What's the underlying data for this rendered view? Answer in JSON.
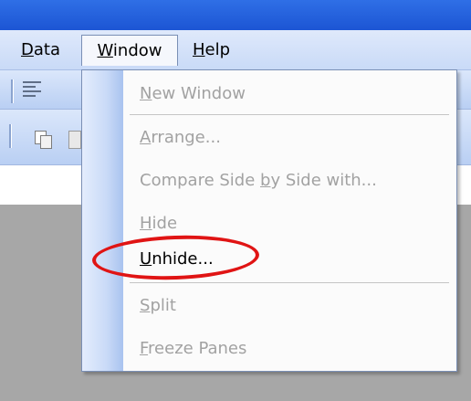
{
  "menubar": {
    "items": [
      {
        "prefix": "",
        "mnemonic": "D",
        "rest": "ata"
      },
      {
        "prefix": "",
        "mnemonic": "W",
        "rest": "indow"
      },
      {
        "prefix": "",
        "mnemonic": "H",
        "rest": "elp"
      }
    ],
    "active": "Window"
  },
  "window_menu": {
    "items": [
      {
        "prefix": "",
        "mnemonic": "N",
        "rest": "ew Window",
        "enabled": false
      },
      {
        "prefix": "",
        "mnemonic": "A",
        "rest": "rrange...",
        "enabled": false
      },
      {
        "prefix": "Compare Side ",
        "mnemonic": "b",
        "rest": "y Side with...",
        "enabled": false
      },
      {
        "prefix": "",
        "mnemonic": "H",
        "rest": "ide",
        "enabled": false
      },
      {
        "prefix": "",
        "mnemonic": "U",
        "rest": "nhide...",
        "enabled": true
      },
      {
        "prefix": "",
        "mnemonic": "S",
        "rest": "plit",
        "enabled": false
      },
      {
        "prefix": "",
        "mnemonic": "F",
        "rest": "reeze Panes",
        "enabled": false
      }
    ]
  },
  "annotation": {
    "color": "#e01414",
    "target": "Unhide..."
  },
  "icons": [
    "align-left-icon",
    "copy-icon",
    "paste-icon"
  ]
}
